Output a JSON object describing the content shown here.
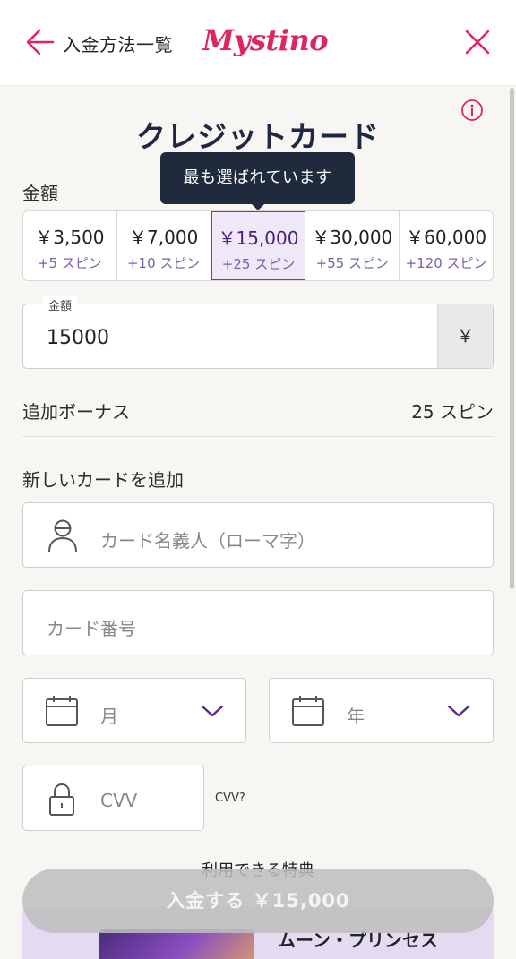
{
  "header": {
    "back_label": "入金方法一覧",
    "logo_text": "Mystino",
    "brand_color": "#e0245e"
  },
  "page": {
    "title": "クレジットカード"
  },
  "amount_section": {
    "label": "金額",
    "tooltip": "最も選ばれています",
    "options": [
      {
        "amount": "￥3,500",
        "spins": "+5 スピン",
        "selected": false
      },
      {
        "amount": "￥7,000",
        "spins": "+10 スピン",
        "selected": false
      },
      {
        "amount": "￥15,000",
        "spins": "+25 スピン",
        "selected": true
      },
      {
        "amount": "￥30,000",
        "spins": "+55 スピン",
        "selected": false
      },
      {
        "amount": "￥60,000",
        "spins": "+120 スピン",
        "selected": false
      }
    ],
    "field_legend": "金額",
    "field_value": "15000",
    "currency_symbol": "￥"
  },
  "bonus": {
    "label": "追加ボーナス",
    "value": "25 スピン"
  },
  "card_form": {
    "label": "新しいカードを追加",
    "holder_placeholder": "カード名義人（ローマ字）",
    "number_placeholder": "カード番号",
    "month_placeholder": "月",
    "year_placeholder": "年",
    "cvv_placeholder": "CVV",
    "cvv_help": "CVV?"
  },
  "promotions": {
    "heading": "利用できる特典",
    "item_name": "ムーン・プリンセス"
  },
  "deposit_button": {
    "label": "入金する ￥15,000"
  },
  "icons": {
    "back": "arrow-left-icon",
    "close": "close-icon",
    "info": "info-icon",
    "user": "user-icon",
    "calendar": "calendar-icon",
    "chevron": "chevron-down-icon",
    "lock": "lock-icon"
  },
  "colors": {
    "accent_pink": "#e0245e",
    "accent_purple": "#6b3fa0",
    "tooltip_bg": "#1f2a3d",
    "title_navy": "#1f2744"
  }
}
